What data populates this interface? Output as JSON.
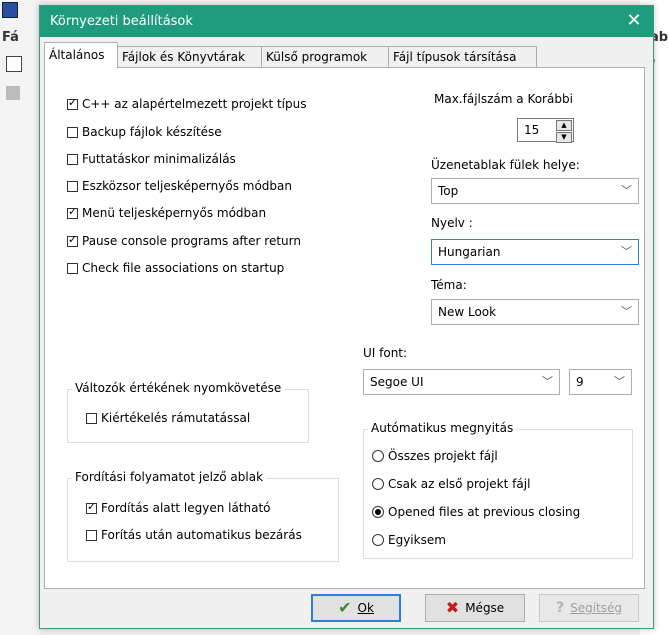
{
  "background": {
    "left_text": "Fá",
    "right_text": "ab",
    "right_mark": "/"
  },
  "dialog": {
    "title": "Környezeti beállítások",
    "close_glyph": "✕"
  },
  "tabs": [
    {
      "label": "Általános",
      "active": true
    },
    {
      "label": "Fájlok és Könyvtárak",
      "active": false
    },
    {
      "label": "Külső programok",
      "active": false
    },
    {
      "label": "Fájl típusok társítása",
      "active": false
    }
  ],
  "options": [
    {
      "label": "C++ az alapértelmezett projekt típus",
      "checked": true
    },
    {
      "label": "Backup fájlok készítése",
      "checked": false
    },
    {
      "label": "Futtatáskor minimalizálás",
      "checked": false
    },
    {
      "label": "Eszközsor teljesképernyős módban",
      "checked": false
    },
    {
      "label": "Menü teljesképernyős módban",
      "checked": true
    },
    {
      "label": "Pause console programs after return",
      "checked": true
    },
    {
      "label": "Check file associations on startup",
      "checked": false
    }
  ],
  "max_files": {
    "label": "Max.fájlszám a Korábbi",
    "value": "15"
  },
  "tab_position": {
    "label": "Üzenetablak fülek helye:",
    "value": "Top"
  },
  "language": {
    "label": "Nyelv :",
    "value": "Hungarian"
  },
  "theme": {
    "label": "Téma:",
    "value": "New Look"
  },
  "ui_font": {
    "label": "UI font:",
    "font": "Segoe UI",
    "size": "9"
  },
  "watch_group": {
    "title": "Változók értékének nyomkövetése",
    "items": [
      {
        "label": "Kiértékelés rámutatással",
        "checked": false
      }
    ]
  },
  "compile_group": {
    "title": "Fordítási folyamatot jelző ablak",
    "items": [
      {
        "label": "Fordítás alatt legyen látható",
        "checked": true
      },
      {
        "label": "Forítás után automatikus bezárás",
        "checked": false
      }
    ]
  },
  "auto_open": {
    "title": "Autómatikus megnyitás",
    "options": [
      {
        "label": "Összes projekt fájl",
        "selected": false
      },
      {
        "label": "Csak az első projekt fájl",
        "selected": false
      },
      {
        "label": "Opened files at previous closing",
        "selected": true
      },
      {
        "label": "Egyiksem",
        "selected": false
      }
    ]
  },
  "buttons": {
    "ok": "Ok",
    "cancel": "Mégse",
    "help": "Segítség"
  },
  "icons": {
    "ok": "check-icon",
    "cancel": "x-icon",
    "help": "question-icon"
  },
  "colors": {
    "titlebar": "#1f9b7d",
    "focus_border": "#2d7fd8"
  }
}
